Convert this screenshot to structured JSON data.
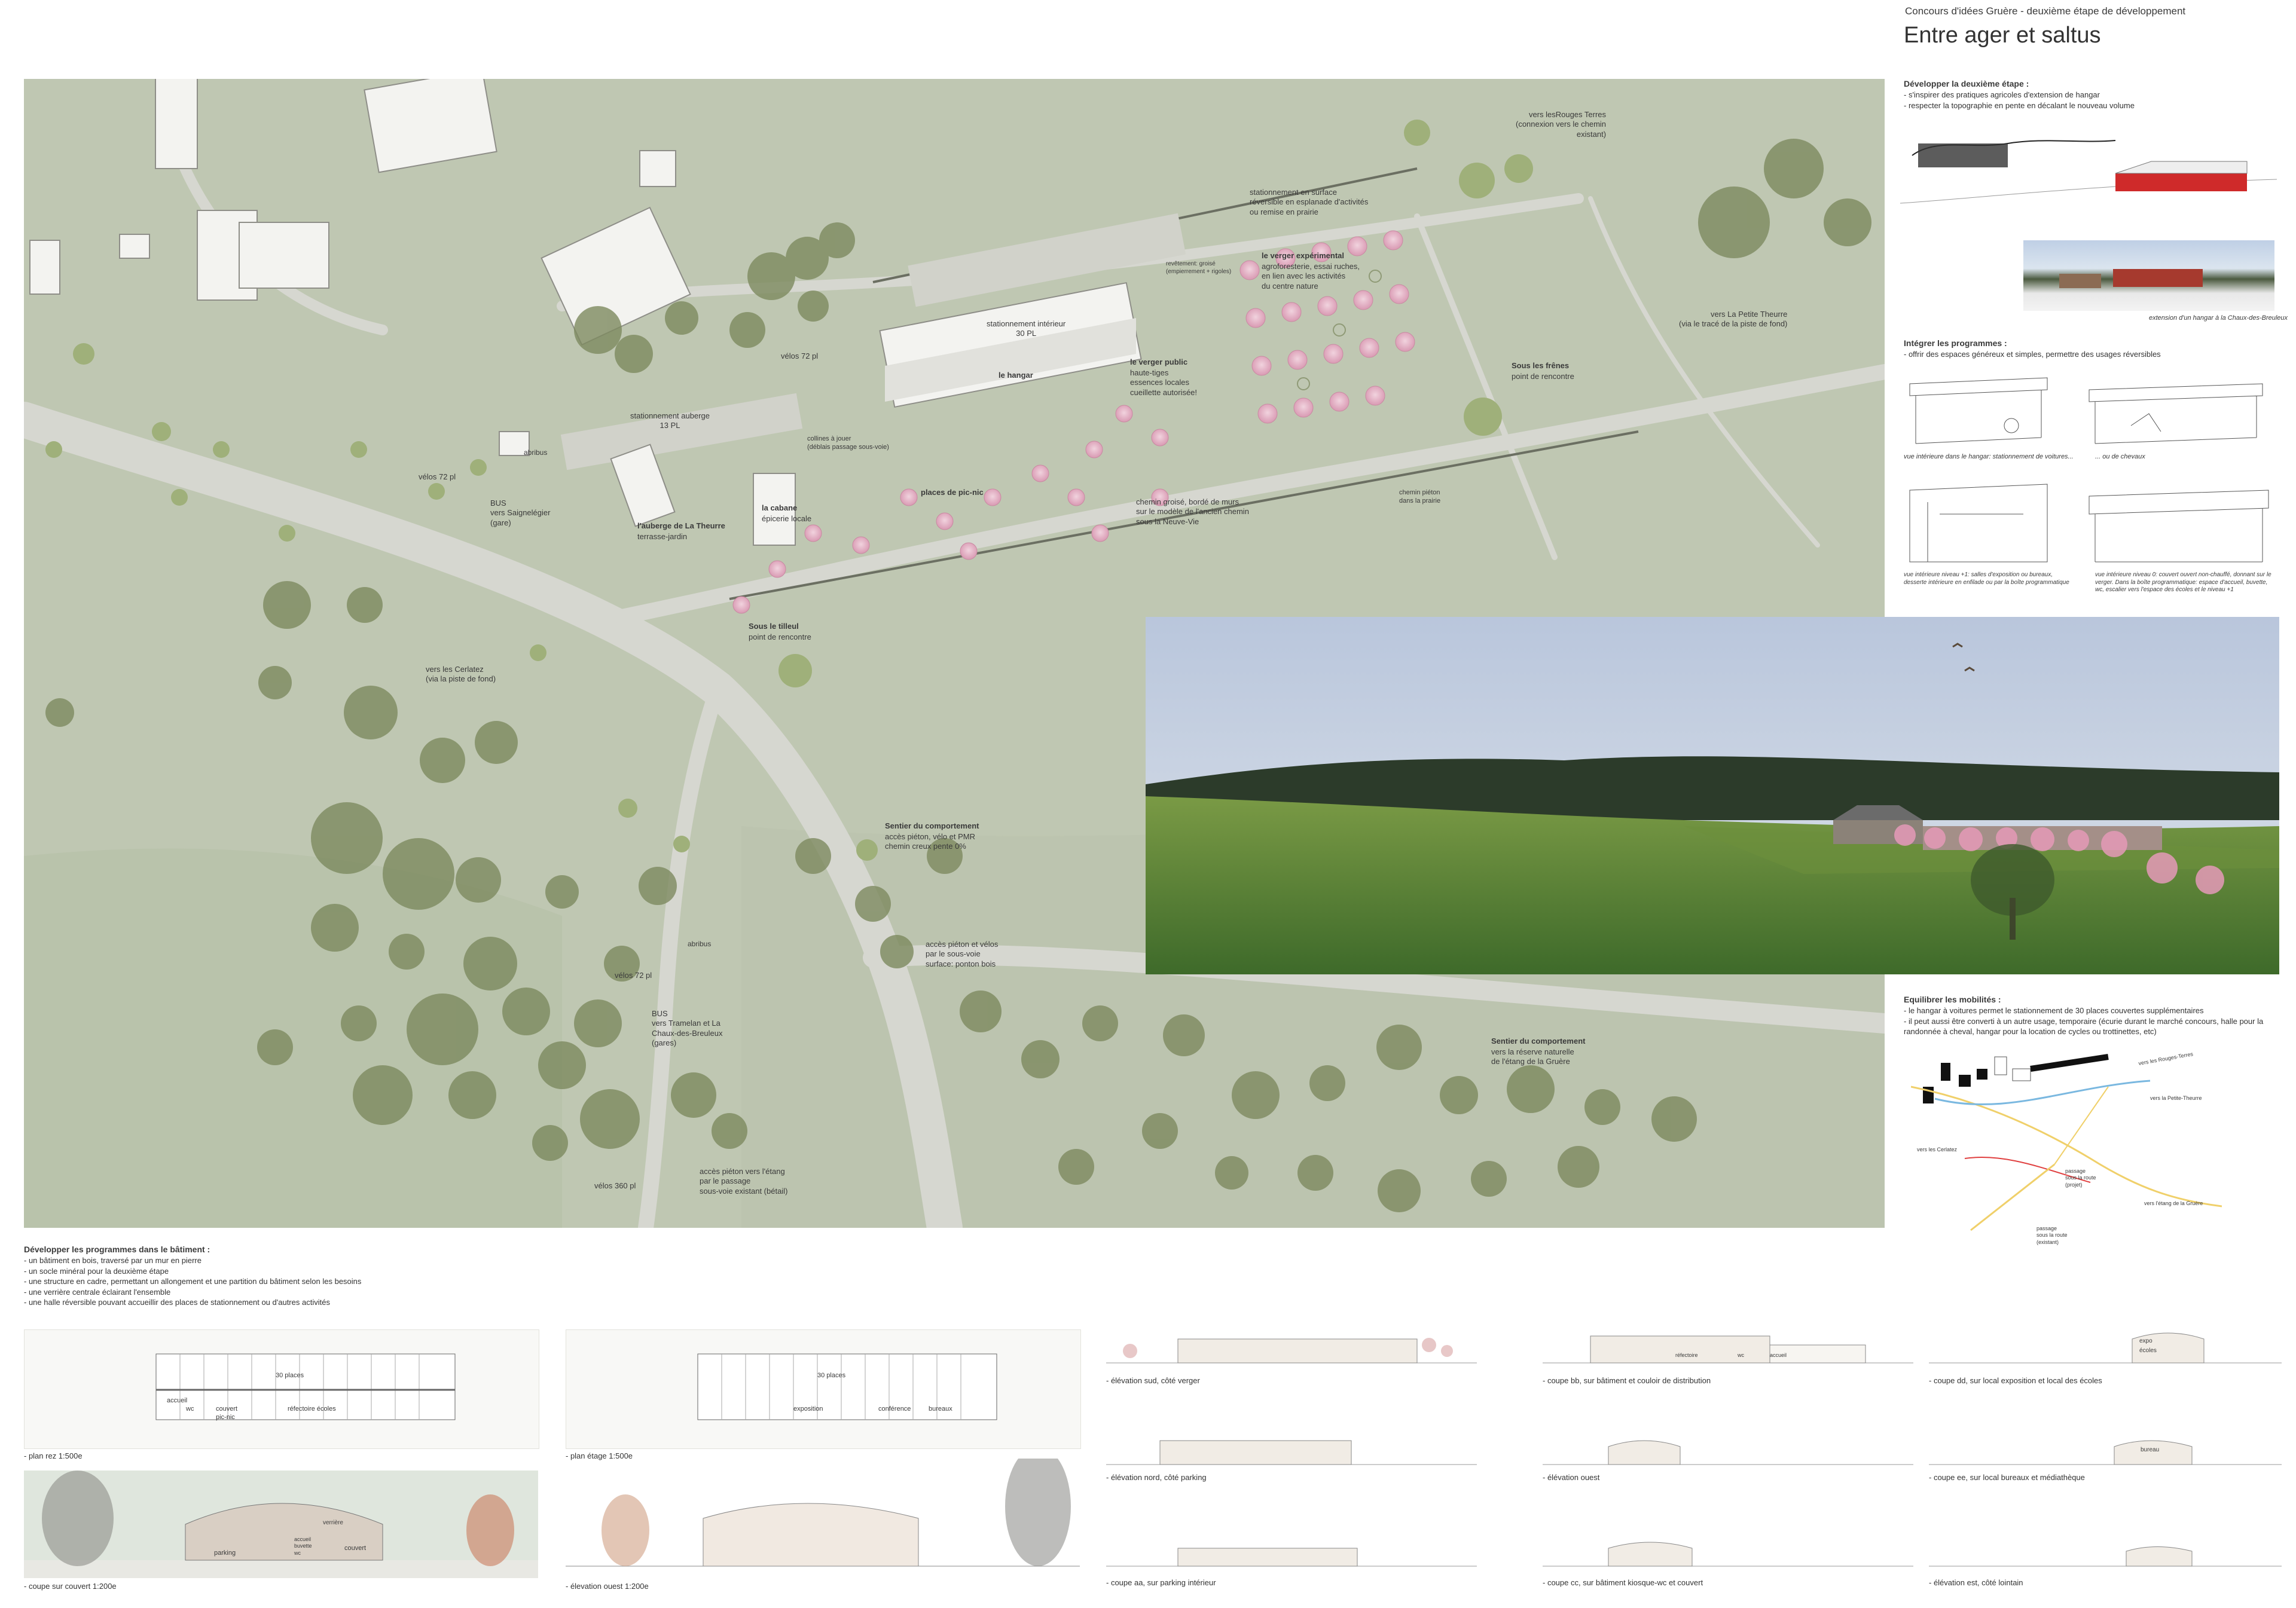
{
  "header": {
    "kicker": "Concours d'idées Gruère - deuxième étape de développement",
    "title": "Entre ager et saltus"
  },
  "plan": {
    "labels": {
      "rouges_terres": "vers lesRouges Terres\n(connexion vers le chemin\nexistant)",
      "stationnement_surface": "stationnement en surface\nréversible en esplanade d'activités\nou remise en prairie",
      "revetement": "revêtement: groisé\n(empierrement + rigoles)",
      "verger_exp_title": "le verger expérimental",
      "verger_exp_text": "agroforesterie, essai ruches,\nen lien avec les activités\ndu centre nature",
      "petite_theurre": "vers La Petite Theurre\n(via le tracé de la piste de fond)",
      "stationnement_interieur": "stationnement intérieur\n30 PL",
      "hangar": "le hangar",
      "velos_72_top": "vélos 72 pl",
      "stationnement_auberge": "stationnement auberge\n13 PL",
      "abribus_top": "abribus",
      "velos_72_left": "vélos 72 pl",
      "bus_saignelegier": "BUS\nvers Saignelégier\n(gare)",
      "collines": "collines à jouer\n(déblais passage sous-voie)",
      "verger_public_title": "le verger public",
      "verger_public_text": "haute-tiges\nessences locales\ncueillette autorisée!",
      "sous_freres_title": "Sous les frênes",
      "sous_freres_text": "point de rencontre",
      "cabane_title": "la cabane",
      "cabane_text": "épicerie locale",
      "picnic": "places de pic-nic",
      "auberge_title": "l'auberge de La Theurre",
      "auberge_text": "terrasse-jardin",
      "chemin_groise": "chemin groisé, bordé de murs\nsur le modèle de l'ancien chemin\nsous la Neuve-Vie",
      "chemin_pieton": "chemin piéton\ndans la prairie",
      "tilleul_title": "Sous le tilleul",
      "tilleul_text": "point de rencontre",
      "cerlatez": "vers les Cerlatez\n(via la piste de fond)",
      "sentier1_title": "Sentier du comportement",
      "sentier1_text": "accès piéton, vélo et PMR\nchemin creux pente 0%",
      "abribus_low": "abribus",
      "acces_pieton": "accès piéton et vélos\npar le sous-voie\nsurface: ponton bois",
      "velos_72_low": "vélos 72 pl",
      "bus_tramelan": "BUS\nvers Tramelan et La\nChaux-des-Breuleux\n(gares)",
      "sentier2_title": "Sentier du comportement",
      "sentier2_text": "vers la réserve naturelle\nde l'étang de la Gruère",
      "velos_360": "vélos 360 pl",
      "acces_etang": "accès piéton vers l'étang\npar le passage\nsous-voie existant (bétail)"
    }
  },
  "right": {
    "dev_title": "Développer la deuxième étape :",
    "dev_items": [
      "- s'inspirer des pratiques agricoles d'extension de hangar",
      "- respecter la topographie en pente en décalant le nouveau volume"
    ],
    "photo_caption": "extension d'un hangar à la Chaux-des-Breuleux",
    "integrer_title": "Intégrer les programmes :",
    "integrer_items": [
      "- offrir des espaces généreux et simples, permettre des usages réversibles"
    ],
    "sketch1": "vue intérieure dans le hangar: stationnement de voitures...",
    "sketch2": "... ou de chevaux",
    "sketch3": "vue intérieure niveau +1: salles d'exposition ou bureaux,\ndesserte intérieure en enfilade ou par la boîte programmatique",
    "sketch4": "vue intérieure niveau 0: couvert ouvert non-chauffé, donnant sur le\nverger. Dans la boîte programmatique: espace d'accueil, buvette,\nwc, escalier vers l'espace des écoles et le niveau +1",
    "equilibrer_title": "Equilibrer les mobilités :",
    "equilibrer_items": [
      "- le hangar à voitures permet le stationnement de 30 places couvertes supplémentaires",
      "- il peut aussi être converti à un autre usage, temporaire (écurie durant le marché concours, halle pour la randonnée à cheval, hangar pour la location de cycles ou trottinettes, etc)"
    ],
    "mini_labels": {
      "rouges": "vers les Rouges-Terres",
      "petite": "vers la Petite-Theurre",
      "cerlatez": "vers les Cerlatez",
      "passage1": "passage\nsous la route\n(projet)",
      "passage2": "passage\nsous la route\n(existant)",
      "gruere": "vers l'étang de la Gruère"
    }
  },
  "bottom": {
    "dev_title": "Développer les programmes dans le bâtiment :",
    "dev_items": [
      "- un bâtiment en bois, traversé par un mur en pierre",
      "- un socle minéral pour la deuxième étape",
      "- une structure en cadre, permettant un allongement et une partition du bâtiment selon les besoins",
      "- une verrière centrale éclairant l'ensemble",
      "- une halle réversible pouvant accueillir des places de stationnement ou d'autres activités"
    ],
    "plan_rez": "- plan rez 1:500e",
    "plan_rez_labels": {
      "places": "30 places",
      "accueil": "accueil",
      "couvert": "couvert\npic-nic",
      "refectoire": "réfectoire écoles",
      "wc": "wc"
    },
    "plan_etage": "- plan étage 1:500e",
    "plan_etage_labels": {
      "places": "30 places",
      "exposition": "exposition",
      "conference": "conférence",
      "bureaux": "bureaux"
    },
    "coupe_couvert": "- coupe sur couvert 1:200e",
    "coupe_labels": {
      "verriere": "verrière",
      "parking": "parking",
      "accueil": "accueil\nbuvette\nwc",
      "couvert": "couvert"
    },
    "elev_ouest_200": "- élevation ouest 1:200e",
    "elev_sud": "- élévation sud, côté verger",
    "elev_nord": "- élévation nord, côté parking",
    "coupe_aa": "- coupe aa, sur parking intérieur",
    "coupe_bb": "- coupe bb, sur bâtiment et couloir de distribution",
    "coupe_bb_labels": {
      "refectoire": "réfectoire",
      "wc": "wc",
      "accueil": "accueil"
    },
    "elev_ouest": "- élévation ouest",
    "coupe_cc": "- coupe cc, sur bâtiment kiosque-wc et couvert",
    "coupe_dd": "- coupe dd, sur local exposition et local des écoles",
    "coupe_dd_labels": {
      "expo": "expo",
      "ecoles": "écoles"
    },
    "coupe_ee": "- coupe ee, sur local bureaux et médiathèque",
    "coupe_ee_labels": {
      "bureau": "bureau"
    },
    "elev_est": "- élévation est, côté lointain"
  },
  "colors": {
    "meadow": "#bfc7b2",
    "tree": "#7d8a5f",
    "blossom": "#e6b6c8",
    "road": "#d8d8d2",
    "accent_red": "#c0392b"
  }
}
